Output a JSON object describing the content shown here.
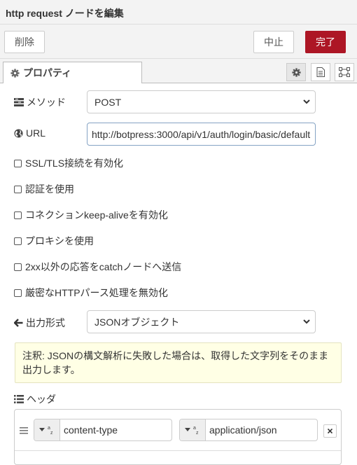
{
  "dialog": {
    "title": "http request ノードを編集"
  },
  "toolbar": {
    "delete_label": "削除",
    "cancel_label": "中止",
    "done_label": "完了"
  },
  "tabs": [
    {
      "label": "プロパティ",
      "icon": "gear-icon"
    }
  ],
  "tab_buttons": [
    "gear-icon",
    "description-icon",
    "appearance-icon"
  ],
  "form": {
    "method": {
      "label": "メソッド",
      "value": "POST",
      "icon": "tasks-icon"
    },
    "url": {
      "label": "URL",
      "value": "http://botpress:3000/api/v1/auth/login/basic/default",
      "icon": "globe-icon"
    },
    "checkboxes": [
      {
        "label": "SSL/TLS接続を有効化",
        "checked": false
      },
      {
        "label": "認証を使用",
        "checked": false
      },
      {
        "label": "コネクションkeep-aliveを有効化",
        "checked": false
      },
      {
        "label": "プロキシを使用",
        "checked": false
      },
      {
        "label": "2xx以外の応答をcatchノードへ送信",
        "checked": false
      },
      {
        "label": "厳密なHTTPパース処理を無効化",
        "checked": false
      }
    ],
    "output": {
      "label": "出力形式",
      "value": "JSONオブジェクト",
      "icon": "arrow-left-icon"
    },
    "tip": "注釈: JSONの構文解析に失敗した場合は、取得した文字列をそのまま出力します。",
    "headers": {
      "label": "ヘッダ",
      "icon": "list-icon",
      "rows": [
        {
          "key": "content-type",
          "value": "application/json"
        }
      ]
    }
  },
  "colors": {
    "primary": "#ad1625",
    "tip_bg": "#ffffe5"
  }
}
